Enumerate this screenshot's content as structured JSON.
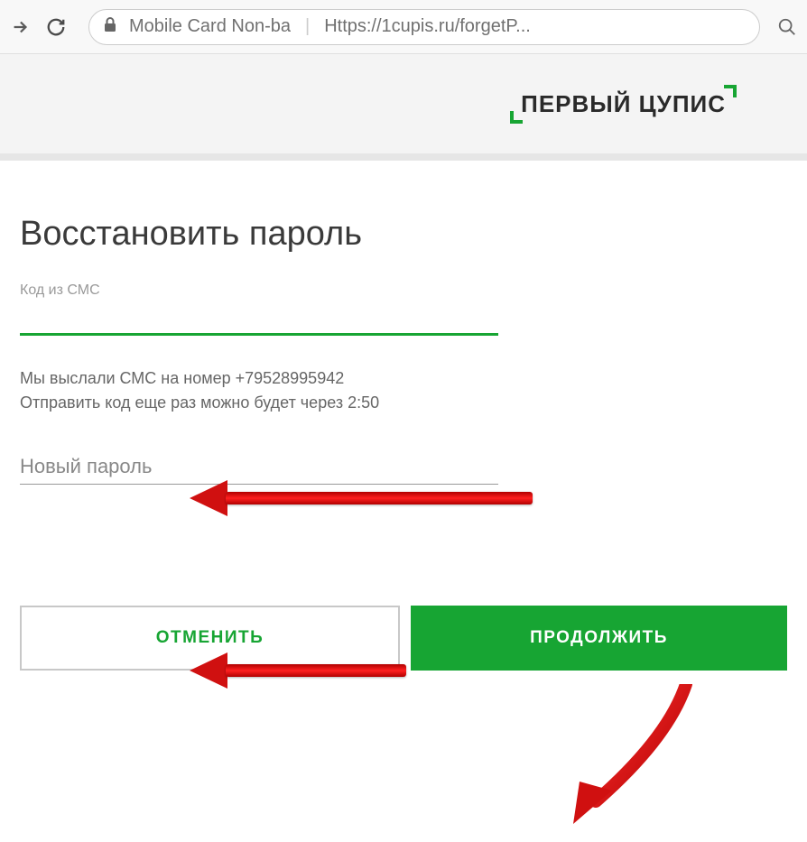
{
  "browser": {
    "page_title": "Mobile Card Non-ba",
    "url": "Https://1cupis.ru/forgetP..."
  },
  "header": {
    "logo_text": "ПЕРВЫЙ ЦУПИС"
  },
  "form": {
    "title": "Восстановить пароль",
    "sms_label": "Код из СМС",
    "sms_value": "",
    "info_line1": "Мы выслали СМС на номер +79528995942",
    "info_line2": "Отправить код еще раз можно будет через 2:50",
    "new_password_label": "Новый пароль",
    "new_password_value": ""
  },
  "buttons": {
    "cancel": "ОТМЕНИТЬ",
    "continue": "ПРОДОЛЖИТЬ"
  }
}
